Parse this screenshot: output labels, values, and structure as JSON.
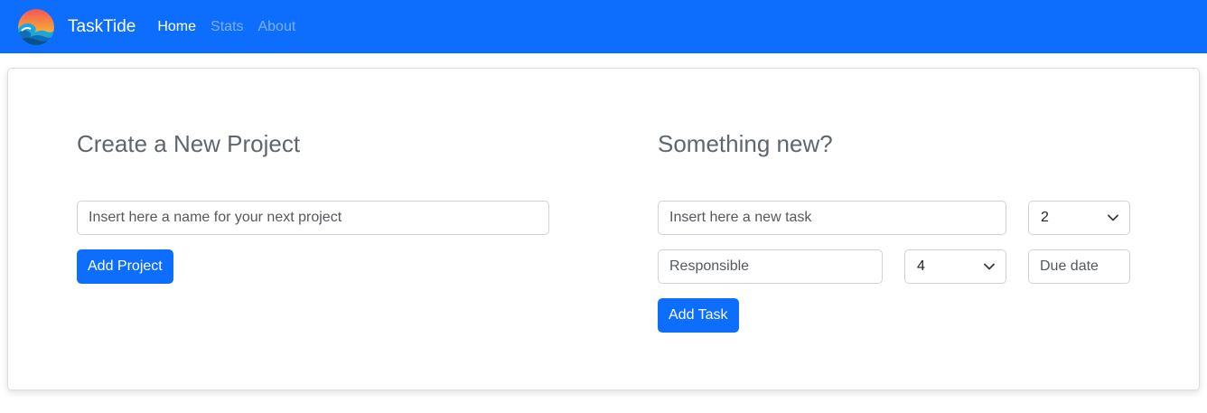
{
  "colors": {
    "navbar_bg": "#0d6efd",
    "primary": "#0d6efd"
  },
  "navbar": {
    "logo_icon": "wave-sun-icon",
    "brand": "TaskTide",
    "links": [
      {
        "label": "Home",
        "active": true
      },
      {
        "label": "Stats",
        "active": false
      },
      {
        "label": "About",
        "active": false
      }
    ]
  },
  "project_section": {
    "title": "Create a New Project",
    "name_input": {
      "value": "",
      "placeholder": "Insert here a name for your next project"
    },
    "add_button": "Add Project"
  },
  "task_section": {
    "title": "Something new?",
    "task_input": {
      "value": "",
      "placeholder": "Insert here a new task"
    },
    "select_1": {
      "selected": "2"
    },
    "responsible_input": {
      "value": "",
      "placeholder": "Responsible"
    },
    "select_2": {
      "selected": "4"
    },
    "due_date_input": {
      "value": "",
      "placeholder": "Due date"
    },
    "add_button": "Add Task"
  }
}
